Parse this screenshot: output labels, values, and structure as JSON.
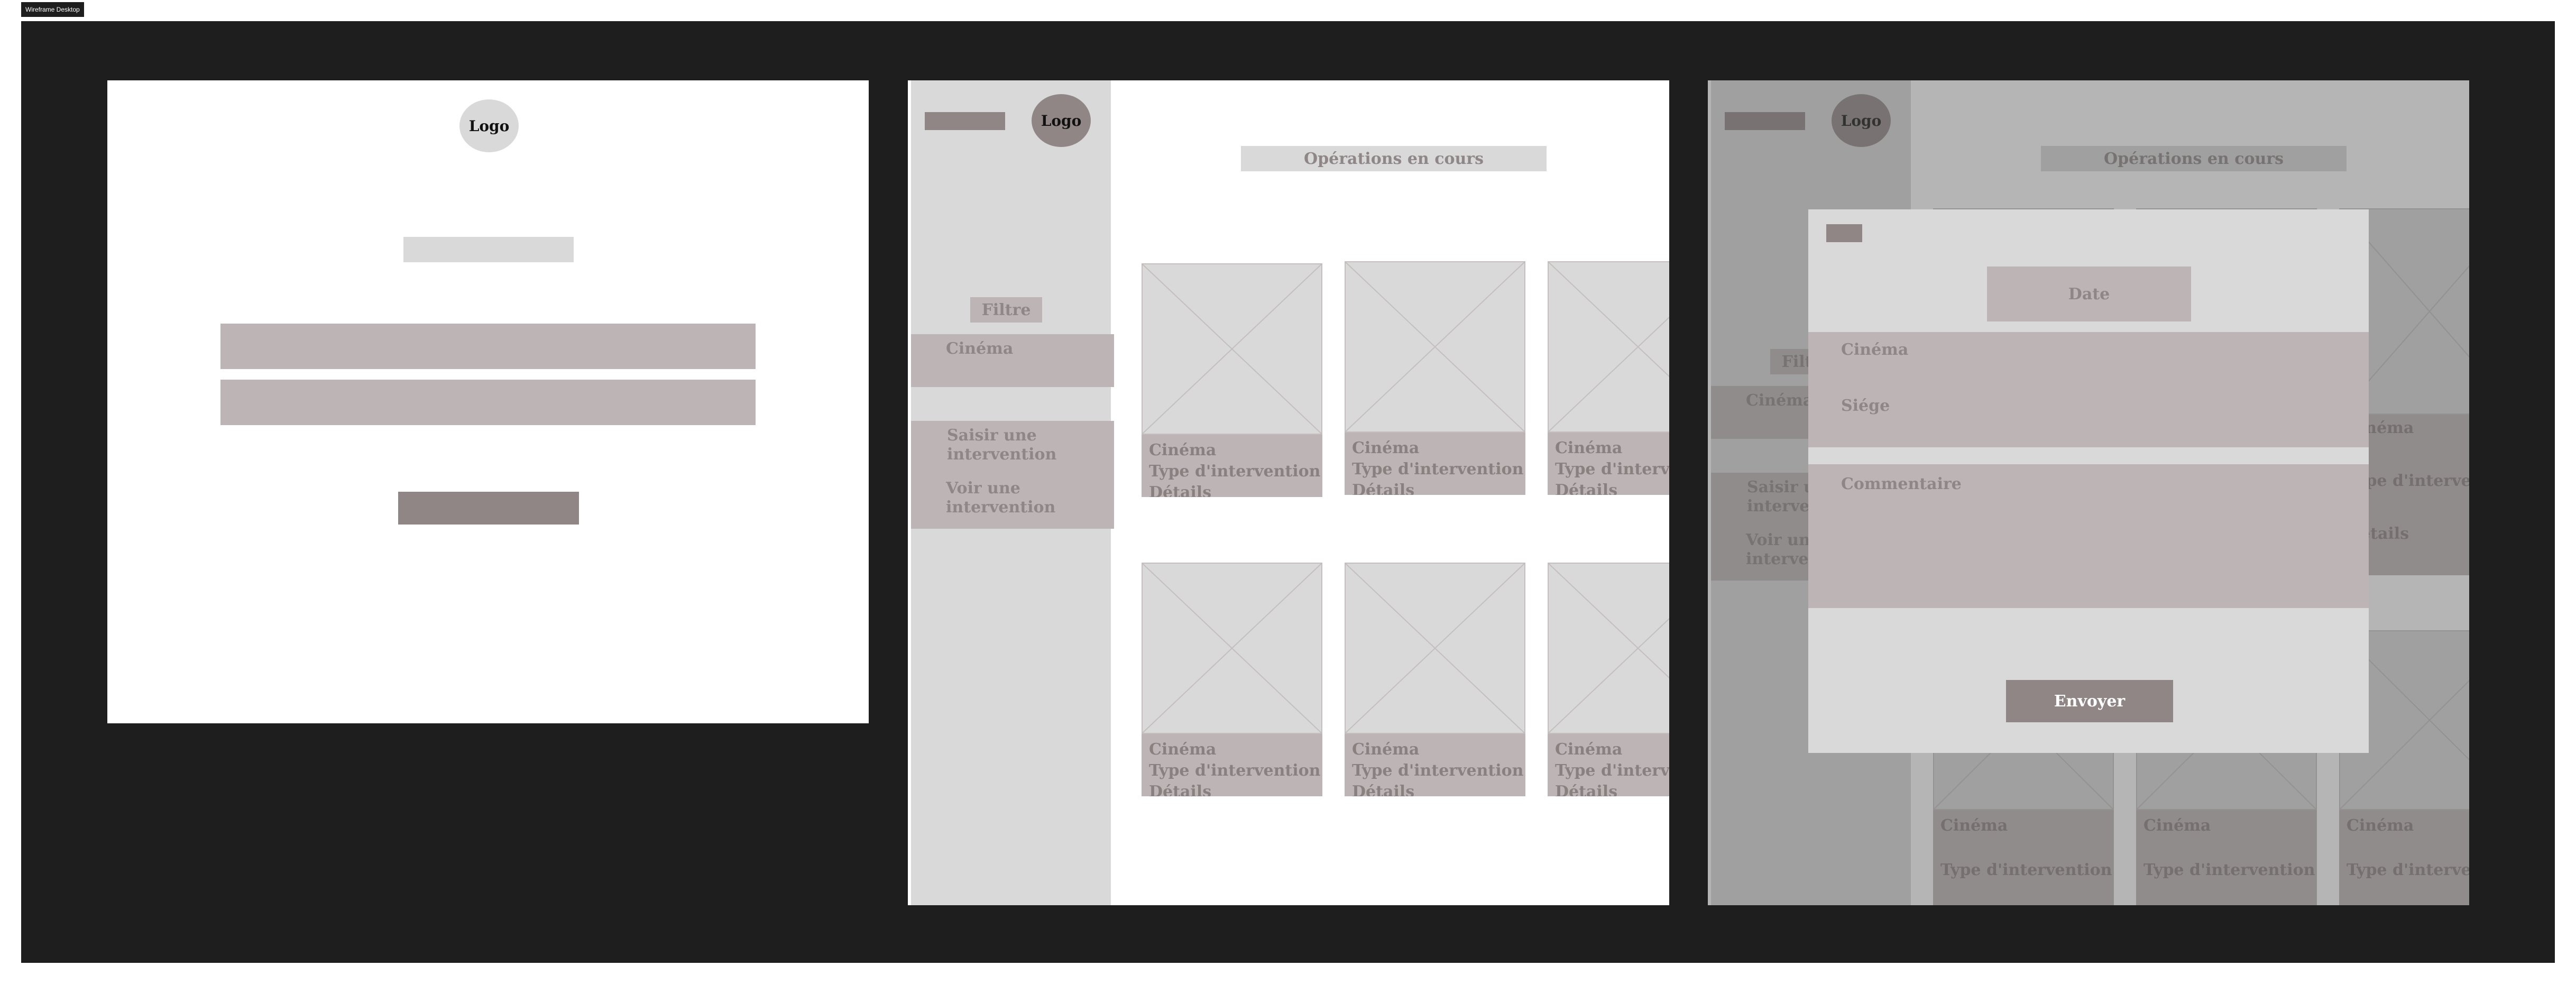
{
  "canvas_tag": "Wireframe Desktop",
  "logo_label": "Logo",
  "operations_title": "Opérations en cours",
  "filter_label": "Filtre",
  "sidebar": {
    "cinema_label": "Cinéma",
    "menu_items": [
      "Saisir une intervention",
      "Voir une intervention"
    ]
  },
  "card": {
    "line1": "Cinéma",
    "line2": "Type d'intervention",
    "line3": "Détails"
  },
  "modal": {
    "date_label": "Date",
    "cinema_label": "Cinéma",
    "seat_label": "Siége",
    "comment_label": "Commentaire",
    "submit_label": "Envoyer"
  },
  "colors": {
    "canvas": "#1e1e1e",
    "placeholder_light": "#d9d9d9",
    "placeholder_mid": "#bdb5b5",
    "placeholder_dark": "#918686",
    "text_muted": "#8f8787"
  }
}
